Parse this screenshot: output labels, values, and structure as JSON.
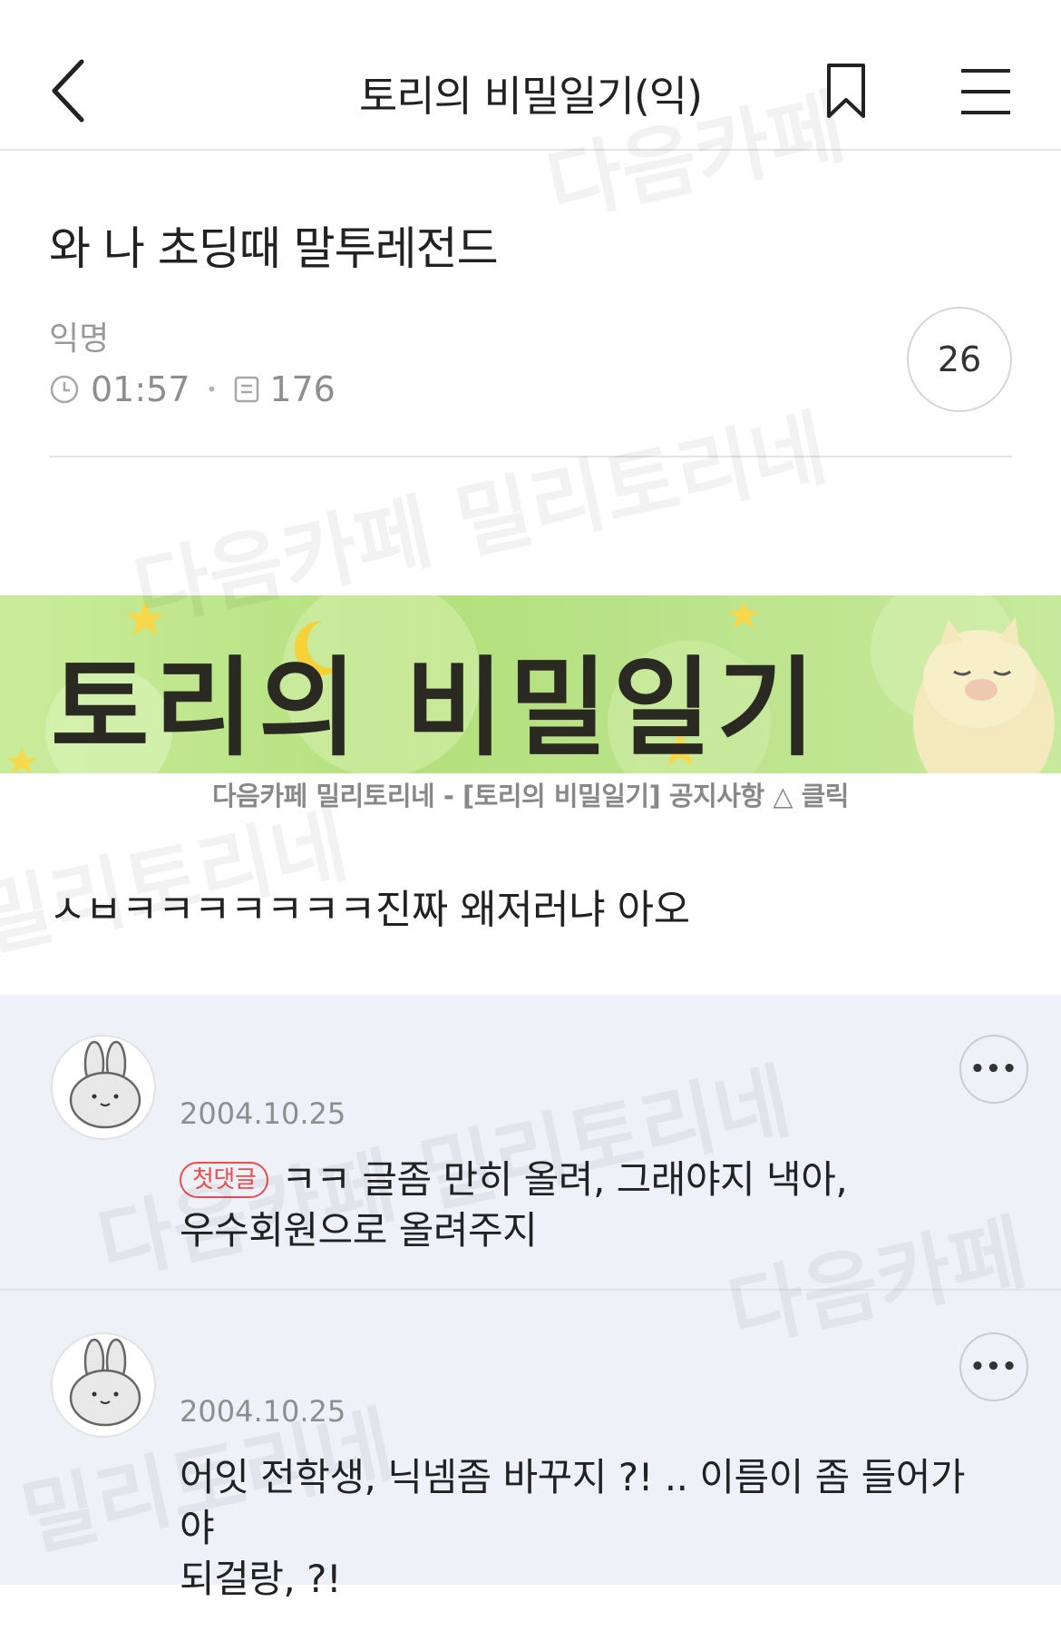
{
  "header": {
    "title": "토리의 비밀일기(익)",
    "back_icon": "chevron-left-icon",
    "bookmark_icon": "bookmark-icon",
    "menu_icon": "hamburger-menu-icon"
  },
  "post": {
    "title": "와 나 초딩때 말투레전드",
    "author": "익명",
    "time": "01:57",
    "views": "176",
    "comment_count": "26",
    "body": "ㅅㅂㅋㅋㅋㅋㅋㅋㅋ진짜 왜저러냐 아오"
  },
  "banner": {
    "text": "토리의 비밀일기",
    "caption": "다음카페 밀리토리네 - [토리의 비밀일기] 공지사항 △ 클릭"
  },
  "comments": [
    {
      "date": "2004.10.25",
      "badge": "첫댓글",
      "text_line1": "ㅋㅋ 글좀 만히 올려, 그래야지 낵아,",
      "text_line2": "우수회원으로 올려주지"
    },
    {
      "date": "2004.10.25",
      "text_line1": "어잇 전학생, 닉넴좀 바꾸지 ?! .. 이름이 좀 들어가야",
      "text_line2": "되걸랑,  ?!"
    }
  ],
  "more_label": "•••",
  "watermarks": [
    "다음카페",
    "밀리토리네",
    "다음카페 밀리토리네"
  ]
}
